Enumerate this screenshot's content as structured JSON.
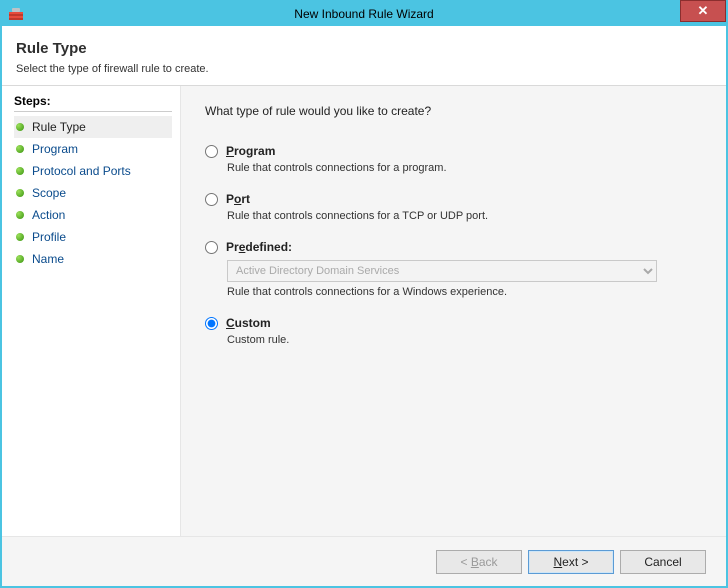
{
  "window": {
    "title": "New Inbound Rule Wizard",
    "close_glyph": "✕"
  },
  "header": {
    "title": "Rule Type",
    "subtitle": "Select the type of firewall rule to create."
  },
  "sidebar": {
    "heading": "Steps:",
    "items": [
      {
        "label": "Rule Type",
        "current": true
      },
      {
        "label": "Program"
      },
      {
        "label": "Protocol and Ports"
      },
      {
        "label": "Scope"
      },
      {
        "label": "Action"
      },
      {
        "label": "Profile"
      },
      {
        "label": "Name"
      }
    ]
  },
  "content": {
    "question": "What type of rule would you like to create?",
    "options": {
      "program": {
        "label_pre": "P",
        "label_post": "rogram",
        "desc": "Rule that controls connections for a program."
      },
      "port": {
        "label_pre": "P",
        "label_mid": "o",
        "label_post": "rt",
        "desc": "Rule that controls connections for a TCP or UDP port."
      },
      "predefined": {
        "label_pre": "Pr",
        "label_mid": "e",
        "label_post": "defined:",
        "select_value": "Active Directory Domain Services",
        "desc": "Rule that controls connections for a Windows experience."
      },
      "custom": {
        "label_pre": "C",
        "label_post": "ustom",
        "desc": "Custom rule."
      }
    },
    "selected": "custom"
  },
  "footer": {
    "back_pre": "< ",
    "back_mid": "B",
    "back_post": "ack",
    "next_pre": "",
    "next_mid": "N",
    "next_post": "ext >",
    "cancel": "Cancel"
  }
}
